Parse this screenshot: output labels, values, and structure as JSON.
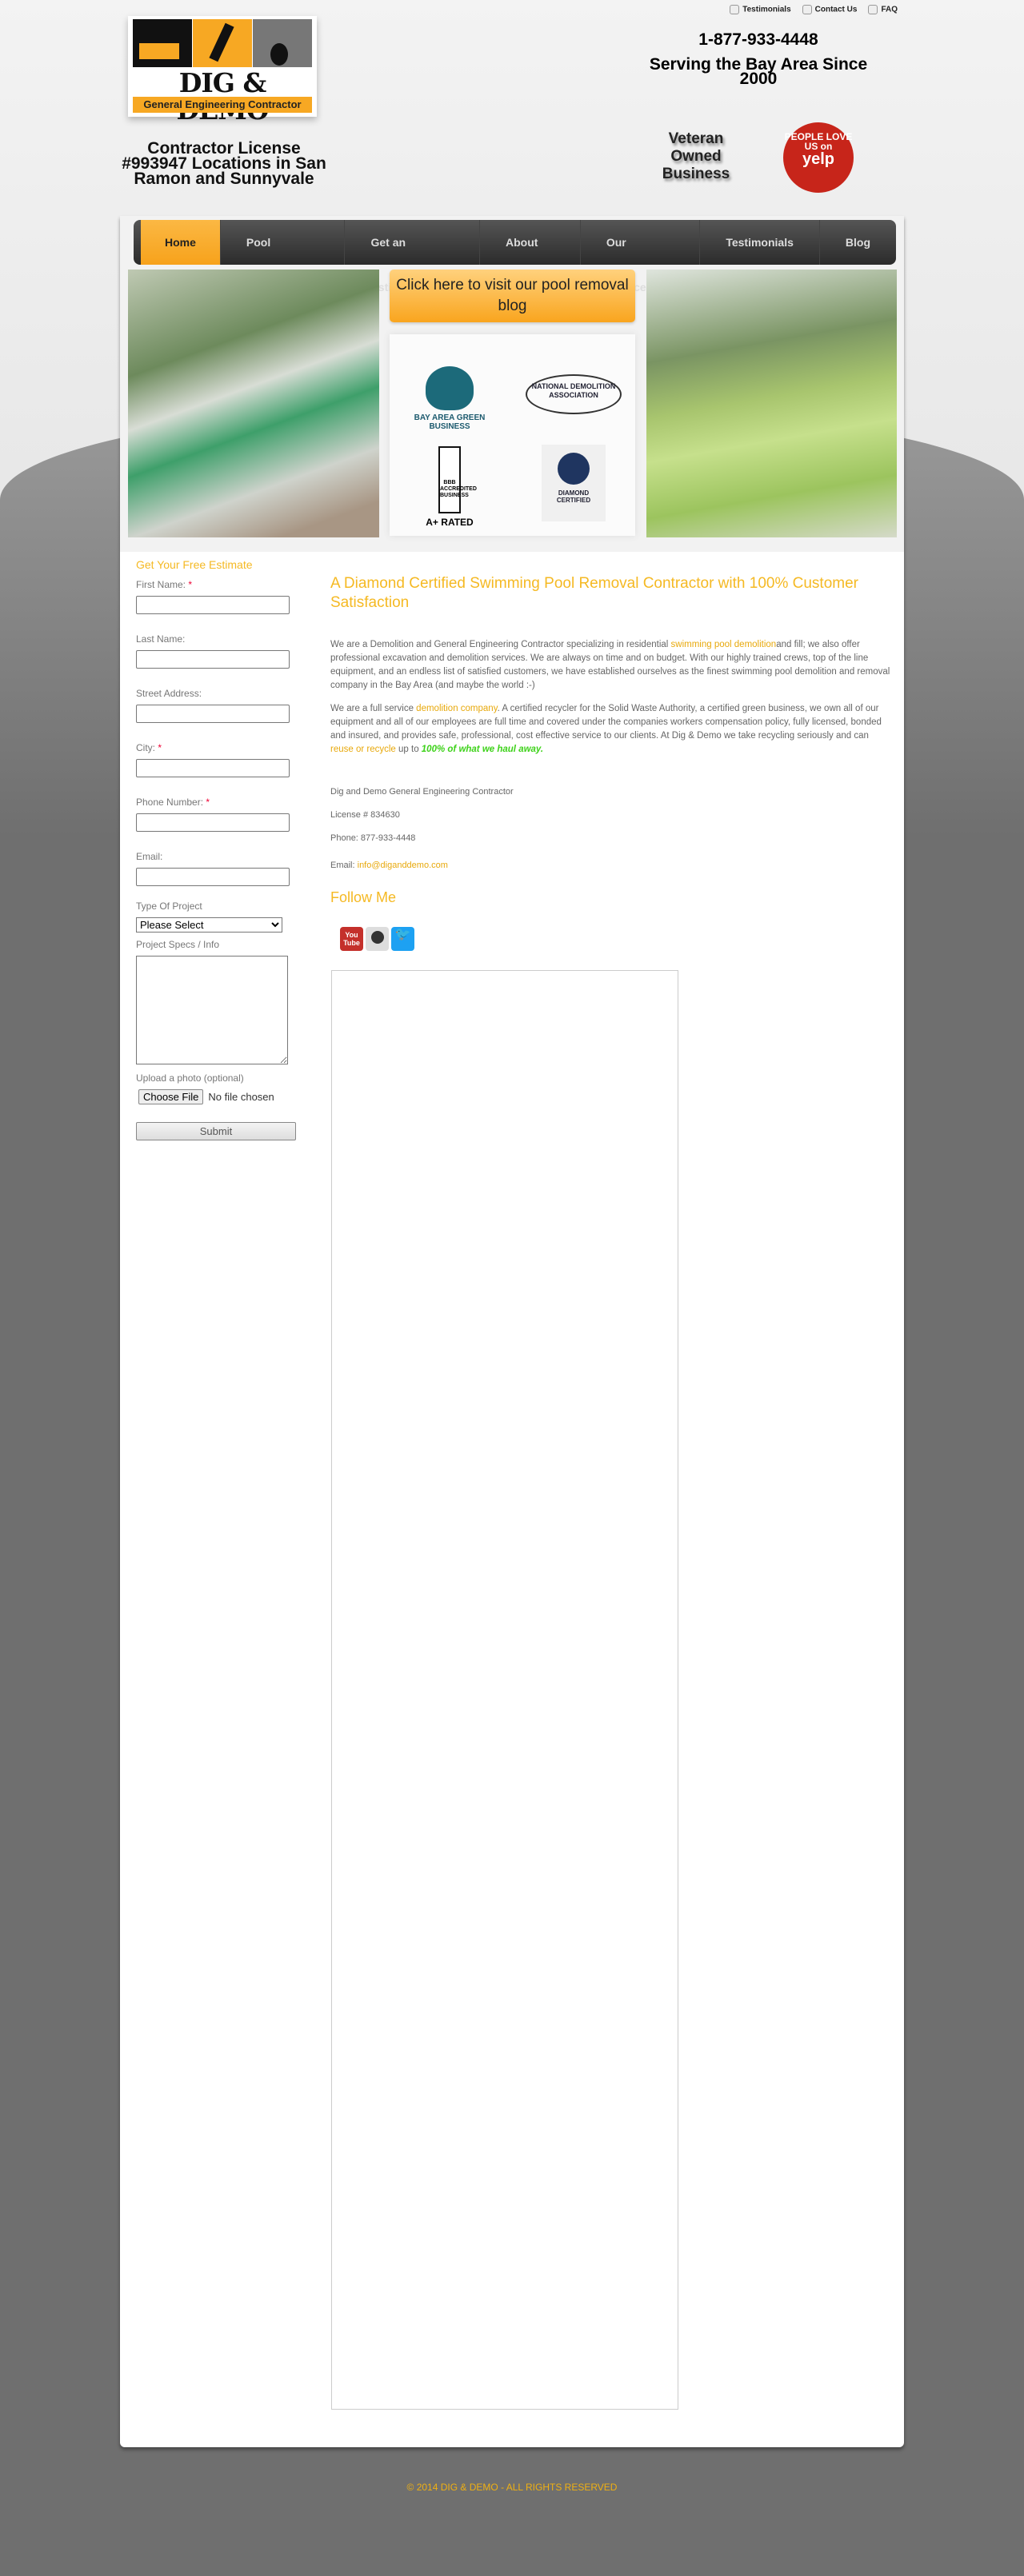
{
  "top_links": [
    {
      "label": "Testimonials",
      "icon": "speech-bubble-icon"
    },
    {
      "label": "Contact Us",
      "icon": "phone-icon"
    },
    {
      "label": "FAQ",
      "icon": "question-icon"
    }
  ],
  "logo": {
    "title": "DIG & DEMO",
    "subtitle": "General Engineering Contractor"
  },
  "header": {
    "license": "Contractor License #993947 Locations in San Ramon and Sunnyvale",
    "phone": "1-877-933-4448",
    "serving": "Serving the Bay Area Since 2000",
    "veteran": "Veteran Owned Business",
    "yelp_top": "PEOPLE LOVE US on",
    "yelp_brand": "yelp"
  },
  "nav": [
    {
      "label": "Home",
      "active": true
    },
    {
      "label": "Pool Removal"
    },
    {
      "label": "Get an Estimate"
    },
    {
      "label": "About Us"
    },
    {
      "label": "Our Services"
    },
    {
      "label": "Testimonials"
    },
    {
      "label": "Blog"
    }
  ],
  "banner": {
    "blog_button": "Click here to visit our pool removal blog",
    "badges": {
      "green": "BAY AREA GREEN BUSINESS",
      "nda": "NATIONAL DEMOLITION ASSOCIATION",
      "bbb": "BBB ACCREDITED BUSINESS",
      "bbb_rating": "A+ RATED",
      "diamond": "DIAMOND CERTIFIED"
    }
  },
  "form": {
    "title": "Get Your Free Estimate",
    "fields": {
      "first": "First Name:",
      "last": "Last Name:",
      "street": "Street Address:",
      "city": "City:",
      "phone": "Phone Number:",
      "email": "Email:",
      "type": "Type Of Project",
      "specs": "Project Specs / Info",
      "upload": "Upload a photo (optional)"
    },
    "required": "*",
    "select_value": "Please Select",
    "file_button": "Choose File",
    "file_status": "No file chosen",
    "submit": "Submit"
  },
  "content": {
    "heading": "A Diamond Certified Swimming Pool Removal Contractor with 100% Customer Satisfaction",
    "p1a": "We are a Demolition and General Engineering Contractor specializing in residential ",
    "p1link": "swimming pool demolition",
    "p1b": "and fill; we also offer professional excavation and demolition services. We are always on time and on budget. With our highly trained crews, top of the line equipment, and an endless list of satisfied customers, we have established ourselves as the finest swimming pool demolition and removal company in the Bay Area (and maybe the world :-)",
    "p2a": "We are a full service ",
    "p2link": "demolition company",
    "p2b": ". A certified recycler for the Solid Waste Authority, a certified green business, we own all of our equipment and all of our employees are full time and covered under the companies workers compensation policy, fully licensed, bonded and insured, and provides safe, professional, cost effective service to our clients.  At Dig & Demo we take recycling seriously and can ",
    "p2link2": "reuse or recycle",
    "p2c": " up to ",
    "p2green": "100% of what we haul away.",
    "company": "Dig and Demo General Engineering Contractor",
    "license": "License # 834630",
    "phone": "Phone: 877-933-4448",
    "email_label": "Email: ",
    "email": "info@diganddemo.com",
    "follow": "Follow Me",
    "social": [
      {
        "name": "YouTube",
        "label": "You Tube",
        "color": "#c4302b"
      },
      {
        "name": "web",
        "label": "",
        "color": "#ddd"
      },
      {
        "name": "Twitter",
        "label": "",
        "color": "#1da1f2"
      }
    ]
  },
  "footer": "© 2014 DIG & DEMO - ALL RIGHTS RESERVED",
  "colors": {
    "accent": "#f5b923",
    "nav_active": "#f7a21b",
    "nav_bg": "#333333",
    "page_bg": "#6f6f6f"
  }
}
